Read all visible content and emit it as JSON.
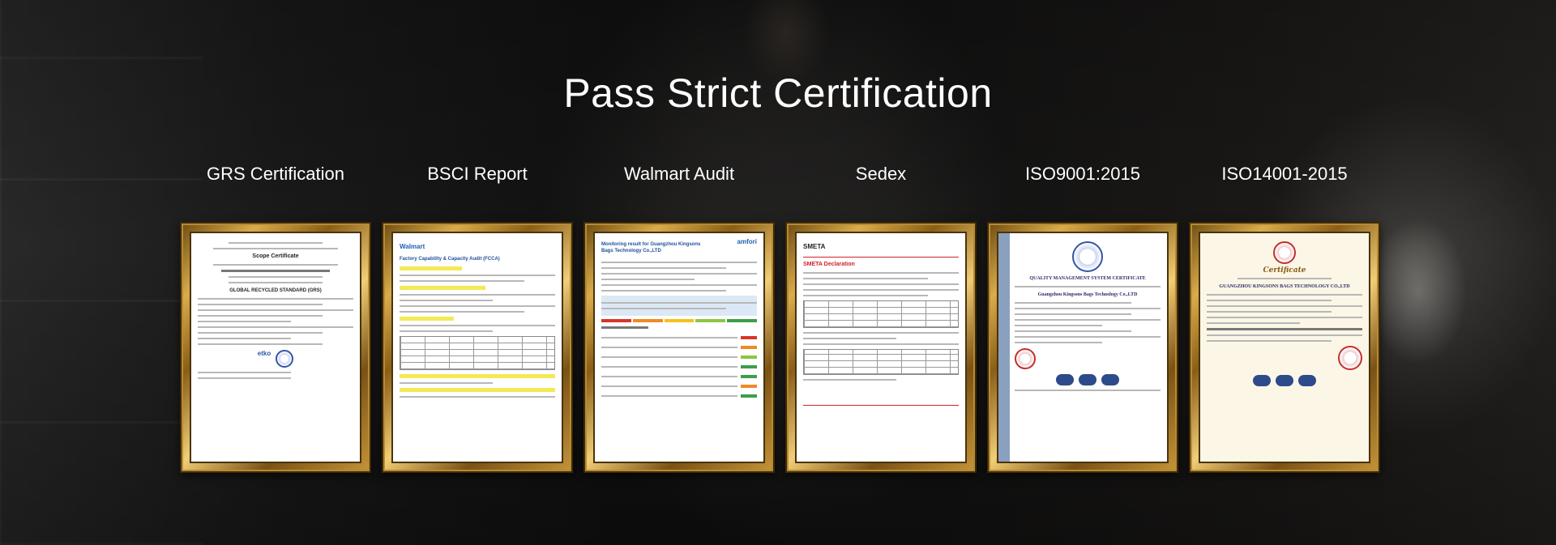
{
  "headline": "Pass Strict Certification",
  "certificates": [
    {
      "label": "GRS Certification",
      "doc_title": "Scope Certificate",
      "doc_subtitle": "GLOBAL RECYCLED STANDARD (GRS)",
      "logo": "etko"
    },
    {
      "label": "BSCI Report",
      "doc_title": "Factory Capability & Capacity Audit (FCCA)",
      "logo": "Walmart"
    },
    {
      "label": "Walmart Audit",
      "doc_title": "Monitoring result for Guangzhou Kingsons Bags Technology Co.,LTD",
      "logo": "amfori"
    },
    {
      "label": "Sedex",
      "doc_title": "SMETA Declaration",
      "logo": "SMETA"
    },
    {
      "label": "ISO9001:2015",
      "doc_title": "QUALITY MANAGEMENT SYSTEM CERTIFICATE",
      "doc_subtitle": "Guangzhou Kingsons Bags Technology Co.,LTD"
    },
    {
      "label": "ISO14001-2015",
      "doc_title": "Certificate",
      "doc_subtitle": "GUANGZHOU KINGSONS BAGS TECHNOLOGY CO.,LTD"
    }
  ],
  "colors": {
    "frame_gold": "#d9ac4b",
    "headline_text": "#ffffff",
    "background": "#151515"
  }
}
